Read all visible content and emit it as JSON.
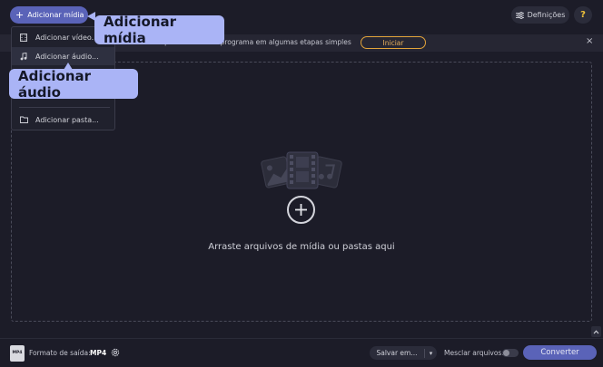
{
  "toolbar": {
    "add_media_label": "Adicionar mídia",
    "settings_label": "Definições",
    "help_label": "?"
  },
  "callouts": {
    "add_media": "Adicionar mídia",
    "add_audio": "Adicionar áudio"
  },
  "dropdown": {
    "items": [
      {
        "label": "Adicionar vídeo...",
        "icon": "film-icon"
      },
      {
        "label": "Adicionar áudio...",
        "icon": "music-note-icon",
        "selected": true
      },
      {
        "label": "Adicionar pasta...",
        "icon": "folder-icon"
      }
    ]
  },
  "banner": {
    "text": "Aprenda a usar o programa em algumas etapas simples",
    "start_label": "Iniciar",
    "close_label": "×"
  },
  "dropzone": {
    "hint": "Arraste arquivos de mídia ou pastas aqui"
  },
  "bottombar": {
    "format_icon_text": "MP4",
    "format_label": "Formato de saída:",
    "format_value": "MP4",
    "save_label": "Salvar em...",
    "merge_label": "Mesclar arquivos:",
    "merge_on": false,
    "convert_label": "Converter"
  },
  "colors": {
    "background": "#1c1c28",
    "accent": "#5a63b8",
    "callout": "#aab4f6",
    "start_outline": "#e3a43a",
    "help": "#f0c23a"
  }
}
